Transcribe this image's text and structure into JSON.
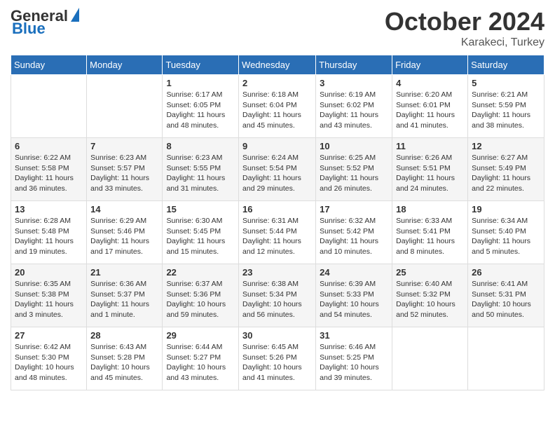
{
  "header": {
    "logo_general": "General",
    "logo_blue": "Blue",
    "month": "October 2024",
    "location": "Karakeci, Turkey"
  },
  "weekdays": [
    "Sunday",
    "Monday",
    "Tuesday",
    "Wednesday",
    "Thursday",
    "Friday",
    "Saturday"
  ],
  "weeks": [
    [
      {
        "day": "",
        "sunrise": "",
        "sunset": "",
        "daylight": ""
      },
      {
        "day": "",
        "sunrise": "",
        "sunset": "",
        "daylight": ""
      },
      {
        "day": "1",
        "sunrise": "Sunrise: 6:17 AM",
        "sunset": "Sunset: 6:05 PM",
        "daylight": "Daylight: 11 hours and 48 minutes."
      },
      {
        "day": "2",
        "sunrise": "Sunrise: 6:18 AM",
        "sunset": "Sunset: 6:04 PM",
        "daylight": "Daylight: 11 hours and 45 minutes."
      },
      {
        "day": "3",
        "sunrise": "Sunrise: 6:19 AM",
        "sunset": "Sunset: 6:02 PM",
        "daylight": "Daylight: 11 hours and 43 minutes."
      },
      {
        "day": "4",
        "sunrise": "Sunrise: 6:20 AM",
        "sunset": "Sunset: 6:01 PM",
        "daylight": "Daylight: 11 hours and 41 minutes."
      },
      {
        "day": "5",
        "sunrise": "Sunrise: 6:21 AM",
        "sunset": "Sunset: 5:59 PM",
        "daylight": "Daylight: 11 hours and 38 minutes."
      }
    ],
    [
      {
        "day": "6",
        "sunrise": "Sunrise: 6:22 AM",
        "sunset": "Sunset: 5:58 PM",
        "daylight": "Daylight: 11 hours and 36 minutes."
      },
      {
        "day": "7",
        "sunrise": "Sunrise: 6:23 AM",
        "sunset": "Sunset: 5:57 PM",
        "daylight": "Daylight: 11 hours and 33 minutes."
      },
      {
        "day": "8",
        "sunrise": "Sunrise: 6:23 AM",
        "sunset": "Sunset: 5:55 PM",
        "daylight": "Daylight: 11 hours and 31 minutes."
      },
      {
        "day": "9",
        "sunrise": "Sunrise: 6:24 AM",
        "sunset": "Sunset: 5:54 PM",
        "daylight": "Daylight: 11 hours and 29 minutes."
      },
      {
        "day": "10",
        "sunrise": "Sunrise: 6:25 AM",
        "sunset": "Sunset: 5:52 PM",
        "daylight": "Daylight: 11 hours and 26 minutes."
      },
      {
        "day": "11",
        "sunrise": "Sunrise: 6:26 AM",
        "sunset": "Sunset: 5:51 PM",
        "daylight": "Daylight: 11 hours and 24 minutes."
      },
      {
        "day": "12",
        "sunrise": "Sunrise: 6:27 AM",
        "sunset": "Sunset: 5:49 PM",
        "daylight": "Daylight: 11 hours and 22 minutes."
      }
    ],
    [
      {
        "day": "13",
        "sunrise": "Sunrise: 6:28 AM",
        "sunset": "Sunset: 5:48 PM",
        "daylight": "Daylight: 11 hours and 19 minutes."
      },
      {
        "day": "14",
        "sunrise": "Sunrise: 6:29 AM",
        "sunset": "Sunset: 5:46 PM",
        "daylight": "Daylight: 11 hours and 17 minutes."
      },
      {
        "day": "15",
        "sunrise": "Sunrise: 6:30 AM",
        "sunset": "Sunset: 5:45 PM",
        "daylight": "Daylight: 11 hours and 15 minutes."
      },
      {
        "day": "16",
        "sunrise": "Sunrise: 6:31 AM",
        "sunset": "Sunset: 5:44 PM",
        "daylight": "Daylight: 11 hours and 12 minutes."
      },
      {
        "day": "17",
        "sunrise": "Sunrise: 6:32 AM",
        "sunset": "Sunset: 5:42 PM",
        "daylight": "Daylight: 11 hours and 10 minutes."
      },
      {
        "day": "18",
        "sunrise": "Sunrise: 6:33 AM",
        "sunset": "Sunset: 5:41 PM",
        "daylight": "Daylight: 11 hours and 8 minutes."
      },
      {
        "day": "19",
        "sunrise": "Sunrise: 6:34 AM",
        "sunset": "Sunset: 5:40 PM",
        "daylight": "Daylight: 11 hours and 5 minutes."
      }
    ],
    [
      {
        "day": "20",
        "sunrise": "Sunrise: 6:35 AM",
        "sunset": "Sunset: 5:38 PM",
        "daylight": "Daylight: 11 hours and 3 minutes."
      },
      {
        "day": "21",
        "sunrise": "Sunrise: 6:36 AM",
        "sunset": "Sunset: 5:37 PM",
        "daylight": "Daylight: 11 hours and 1 minute."
      },
      {
        "day": "22",
        "sunrise": "Sunrise: 6:37 AM",
        "sunset": "Sunset: 5:36 PM",
        "daylight": "Daylight: 10 hours and 59 minutes."
      },
      {
        "day": "23",
        "sunrise": "Sunrise: 6:38 AM",
        "sunset": "Sunset: 5:34 PM",
        "daylight": "Daylight: 10 hours and 56 minutes."
      },
      {
        "day": "24",
        "sunrise": "Sunrise: 6:39 AM",
        "sunset": "Sunset: 5:33 PM",
        "daylight": "Daylight: 10 hours and 54 minutes."
      },
      {
        "day": "25",
        "sunrise": "Sunrise: 6:40 AM",
        "sunset": "Sunset: 5:32 PM",
        "daylight": "Daylight: 10 hours and 52 minutes."
      },
      {
        "day": "26",
        "sunrise": "Sunrise: 6:41 AM",
        "sunset": "Sunset: 5:31 PM",
        "daylight": "Daylight: 10 hours and 50 minutes."
      }
    ],
    [
      {
        "day": "27",
        "sunrise": "Sunrise: 6:42 AM",
        "sunset": "Sunset: 5:30 PM",
        "daylight": "Daylight: 10 hours and 48 minutes."
      },
      {
        "day": "28",
        "sunrise": "Sunrise: 6:43 AM",
        "sunset": "Sunset: 5:28 PM",
        "daylight": "Daylight: 10 hours and 45 minutes."
      },
      {
        "day": "29",
        "sunrise": "Sunrise: 6:44 AM",
        "sunset": "Sunset: 5:27 PM",
        "daylight": "Daylight: 10 hours and 43 minutes."
      },
      {
        "day": "30",
        "sunrise": "Sunrise: 6:45 AM",
        "sunset": "Sunset: 5:26 PM",
        "daylight": "Daylight: 10 hours and 41 minutes."
      },
      {
        "day": "31",
        "sunrise": "Sunrise: 6:46 AM",
        "sunset": "Sunset: 5:25 PM",
        "daylight": "Daylight: 10 hours and 39 minutes."
      },
      {
        "day": "",
        "sunrise": "",
        "sunset": "",
        "daylight": ""
      },
      {
        "day": "",
        "sunrise": "",
        "sunset": "",
        "daylight": ""
      }
    ]
  ]
}
